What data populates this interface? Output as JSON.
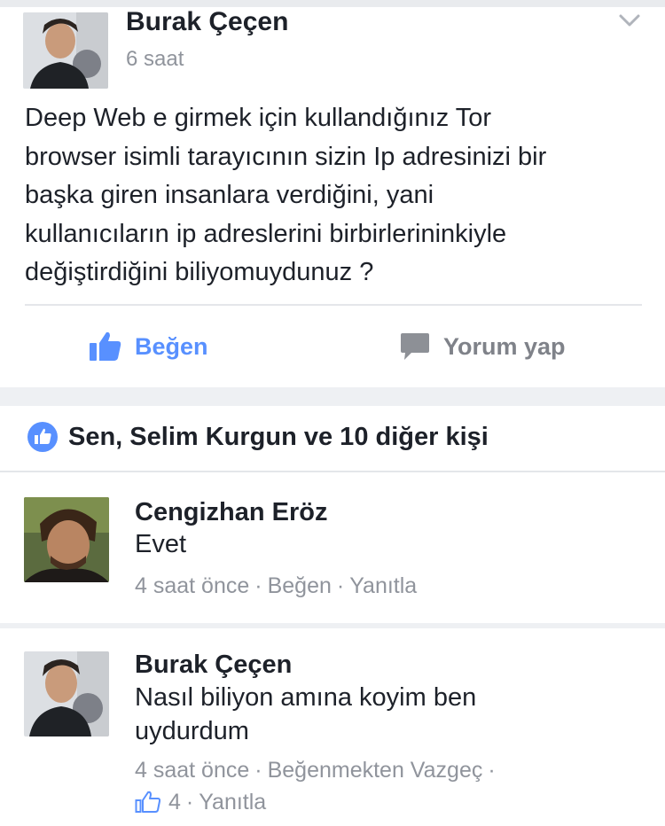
{
  "post": {
    "author": "Burak Çeçen",
    "time": "6 saat",
    "text_lines": [
      "Deep Web e girmek için kullandığınız Tor",
      "browser isimli tarayıcının sizin Ip adresinizi bir",
      "başka giren insanlara verdiğini, yani",
      "kullanıcıların ip adreslerini birbirlerininkiyle",
      "değiştirdiğini biliyomuydunuz ?"
    ]
  },
  "actions": {
    "like_label": "Beğen",
    "comment_label": "Yorum yap"
  },
  "reactions": {
    "summary": "Sen, Selim Kurgun ve 10 diğer kişi"
  },
  "comments": [
    {
      "author": "Cengizhan Eröz",
      "text_lines": [
        "Evet"
      ],
      "time": "4 saat önce",
      "like_label": "Beğen",
      "reply_label": "Yanıtla"
    },
    {
      "author": "Burak Çeçen",
      "text_lines": [
        "Nasıl biliyon amına koyim ben",
        "uydurdum"
      ],
      "time": "4 saat önce",
      "like_label": "Beğenmekten Vazgeç",
      "like_count": "4",
      "reply_label": "Yanıtla"
    }
  ],
  "icons": {
    "chevron": "chevron-down-icon",
    "like": "thumbs-up-icon",
    "comment": "speech-bubble-icon",
    "reaction": "like-reaction-icon"
  },
  "colors": {
    "accent_blue": "#5890ff",
    "meta_gray": "#90949c",
    "text": "#1d2129",
    "divider": "#e4e6ea"
  }
}
